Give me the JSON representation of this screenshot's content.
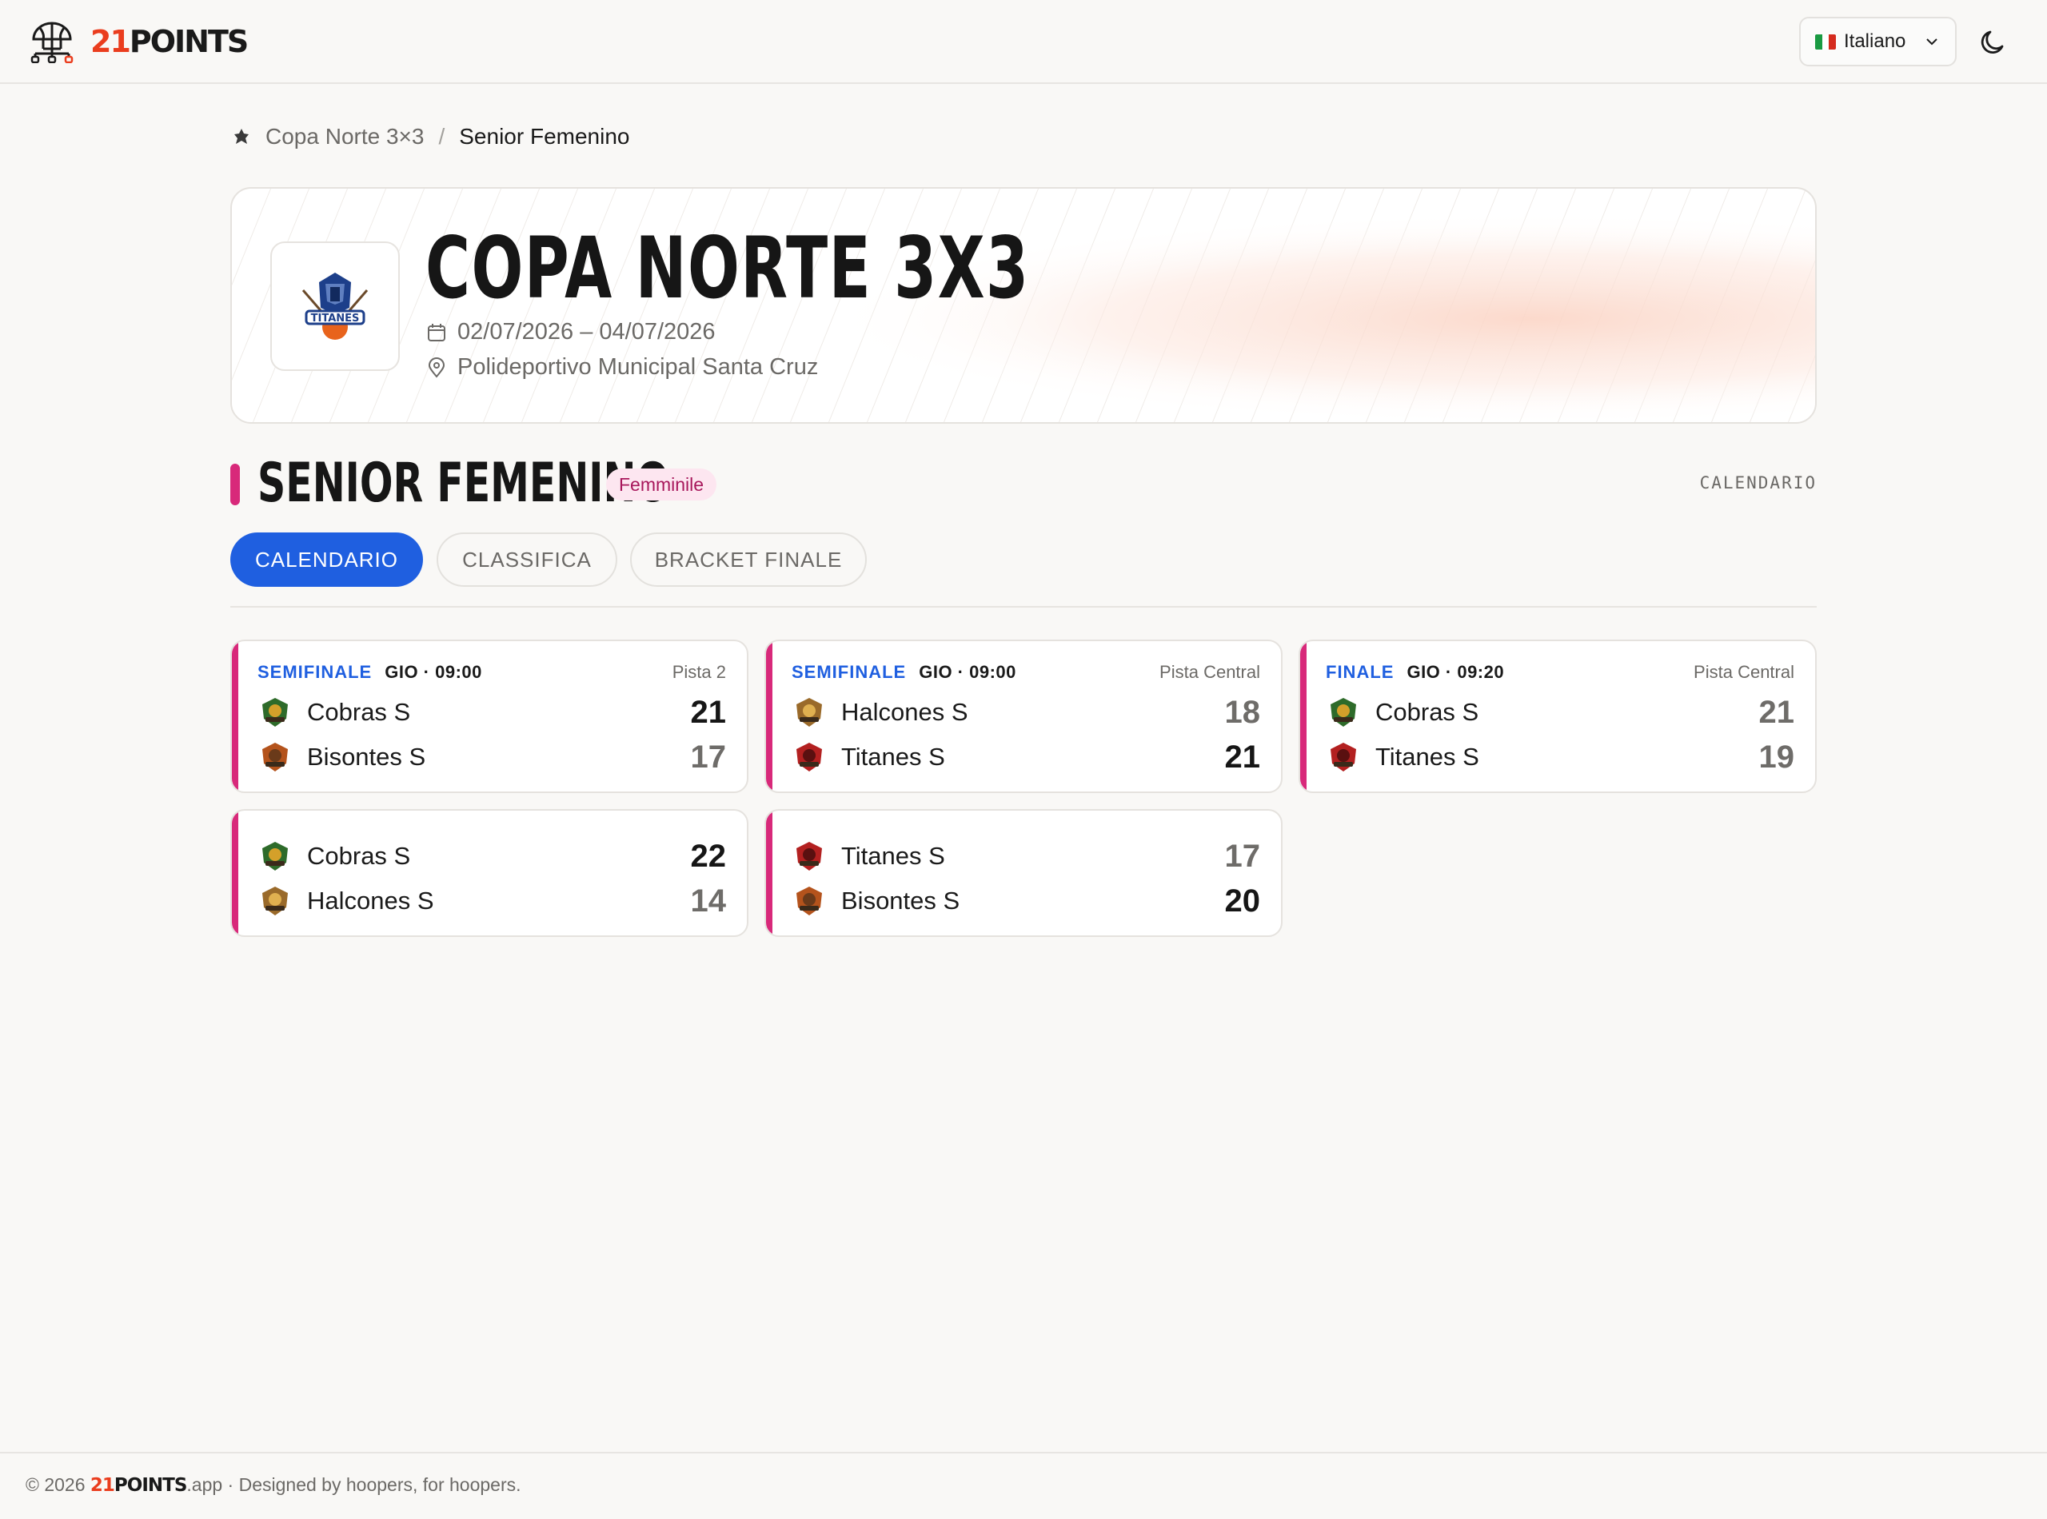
{
  "header": {
    "brand_number": "21",
    "brand_word": "POINTS",
    "language": "Italiano",
    "icons": [
      "basketball-network-icon",
      "chevron-down-icon",
      "moon-icon"
    ]
  },
  "breadcrumb": {
    "tournament": "Copa Norte 3×3",
    "separator": "/",
    "current": "Senior Femenino"
  },
  "hero": {
    "title": "COPA NORTE 3X3",
    "dates": "02/07/2026 – 04/07/2026",
    "venue": "Polideportivo Municipal Santa Cruz",
    "logo_text": "TITANES"
  },
  "section": {
    "title": "SENIOR FEMENINO",
    "badge": "Femminile",
    "right_label": "CALENDARIO",
    "accent_color": "#d8297a"
  },
  "tabs": [
    {
      "label": "CALENDARIO",
      "active": true
    },
    {
      "label": "CLASSIFICA",
      "active": false
    },
    {
      "label": "BRACKET FINALE",
      "active": false
    }
  ],
  "matches": [
    {
      "round": "SEMIFINALE",
      "when": "GIO · 09:00",
      "court": "Pista 2",
      "home": {
        "name": "Cobras S",
        "score": "21",
        "winner": true,
        "color": "#2e6b2a"
      },
      "away": {
        "name": "Bisontes S",
        "score": "17",
        "winner": false,
        "color": "#b4531c"
      }
    },
    {
      "round": "SEMIFINALE",
      "when": "GIO · 09:00",
      "court": "Pista Central",
      "home": {
        "name": "Halcones S",
        "score": "18",
        "winner": false,
        "color": "#9a6a2a"
      },
      "away": {
        "name": "Titanes S",
        "score": "21",
        "winner": true,
        "color": "#b32020"
      }
    },
    {
      "round": "FINALE",
      "when": "GIO · 09:20",
      "court": "Pista Central",
      "home": {
        "name": "Cobras S",
        "score": "21",
        "winner": false,
        "color": "#2e6b2a"
      },
      "away": {
        "name": "Titanes S",
        "score": "19",
        "winner": false,
        "color": "#b32020"
      }
    },
    {
      "round": "",
      "when": "",
      "court": "",
      "home": {
        "name": "Cobras S",
        "score": "22",
        "winner": true,
        "color": "#2e6b2a"
      },
      "away": {
        "name": "Halcones S",
        "score": "14",
        "winner": false,
        "color": "#9a6a2a"
      }
    },
    {
      "round": "",
      "when": "",
      "court": "",
      "home": {
        "name": "Titanes S",
        "score": "17",
        "winner": false,
        "color": "#b32020"
      },
      "away": {
        "name": "Bisontes S",
        "score": "20",
        "winner": true,
        "color": "#b4531c"
      }
    }
  ],
  "footer": {
    "prefix": "© 2026 ",
    "brand_number": "21",
    "brand_word": "POINTS",
    "suffix": ".app · Designed by hoopers, for hoopers."
  },
  "colors": {
    "primary": "#1f5fe0",
    "brand": "#ea3d1e",
    "accent": "#d8297a",
    "background": "#f9f8f6"
  }
}
